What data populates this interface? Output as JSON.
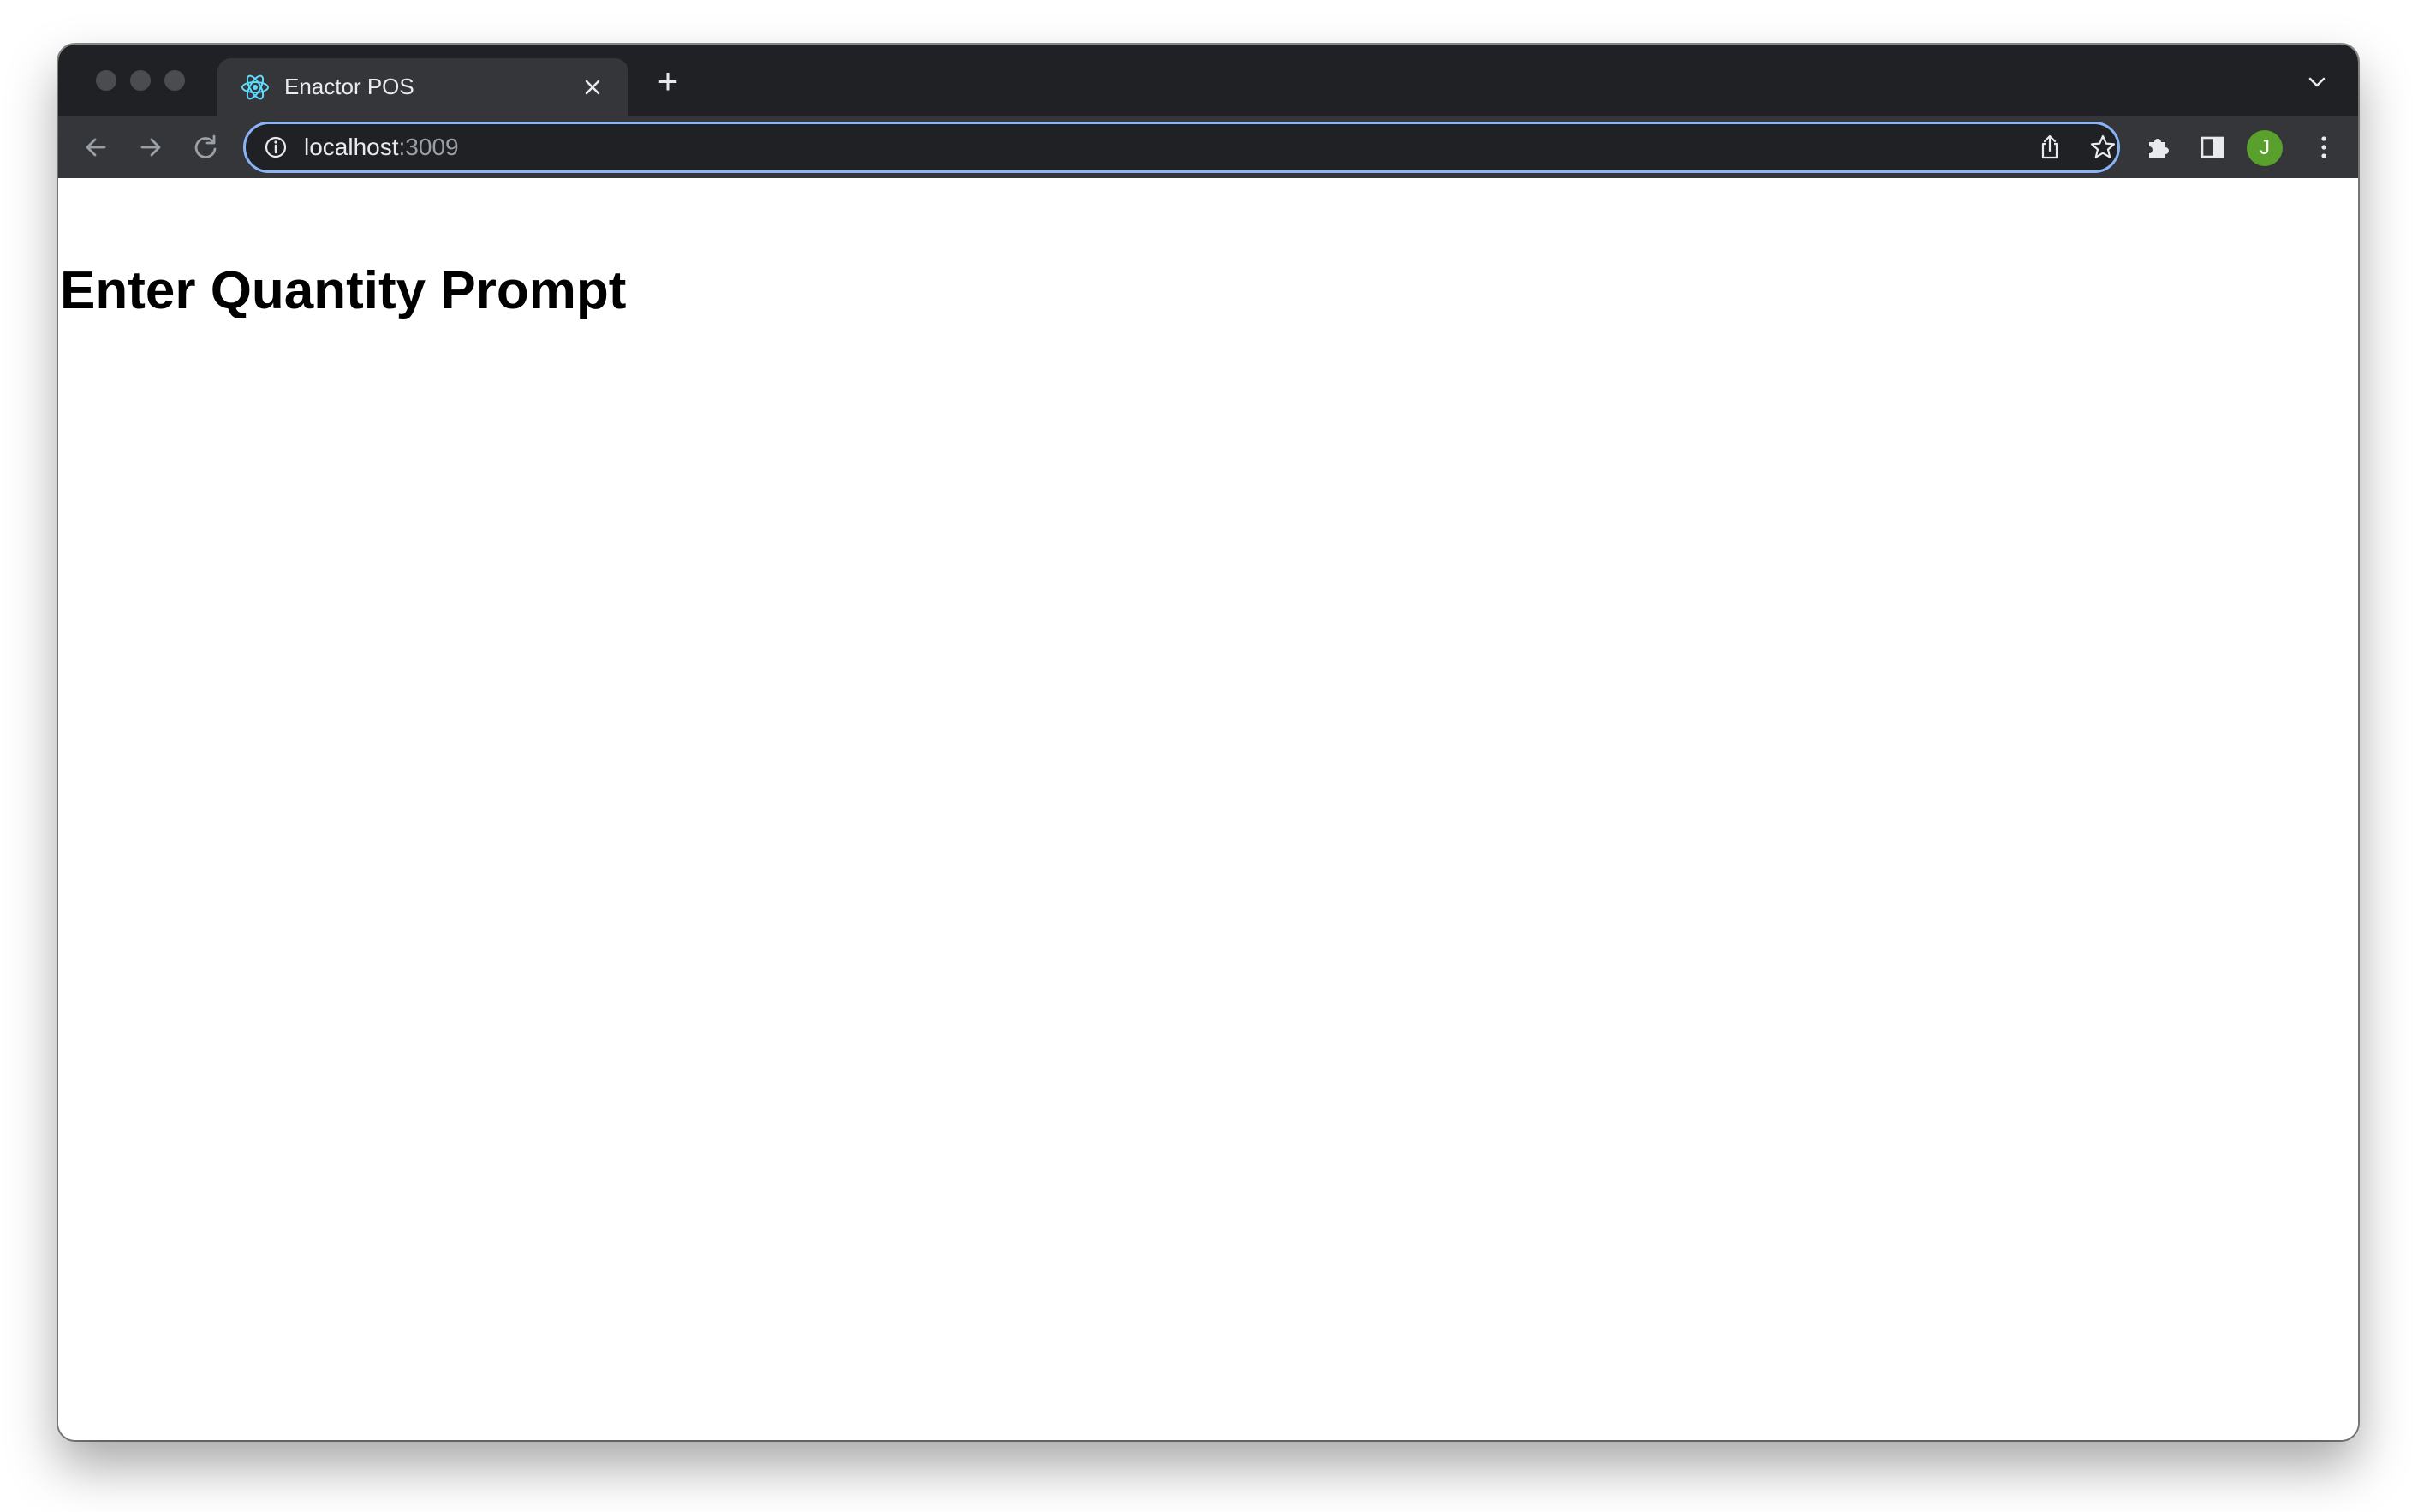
{
  "browser": {
    "tab": {
      "title": "Enactor POS"
    },
    "new_tab_symbol": "+",
    "address_bar": {
      "host": "localhost",
      "port": ":3009"
    },
    "profile_initial": "J",
    "icons": {
      "favicon": "react-atom-icon",
      "close": "close-icon",
      "new_tab": "plus-icon",
      "tab_search": "chevron-down-icon",
      "back": "arrow-left-icon",
      "forward": "arrow-right-icon",
      "reload": "reload-icon",
      "site_info": "info-icon",
      "share": "share-icon",
      "bookmark": "star-icon",
      "extensions": "puzzle-icon",
      "side_panel": "side-panel-icon",
      "menu": "kebab-menu-icon"
    },
    "colors": {
      "titlebar": "#202124",
      "toolbar": "#35363a",
      "omnibox_border": "#8ab4f8",
      "avatar": "#5aa02c",
      "react_blue": "#61dafb"
    }
  },
  "page": {
    "heading": "Enter Quantity Prompt"
  }
}
